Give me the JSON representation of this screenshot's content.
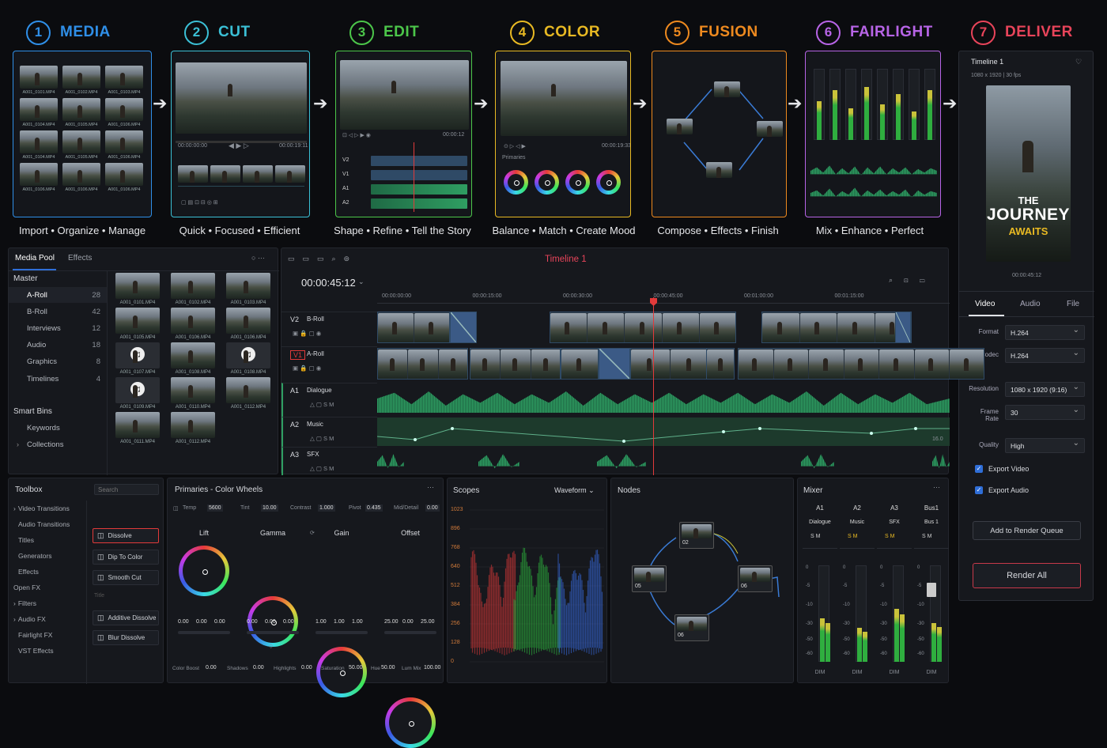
{
  "stages": [
    {
      "num": "1",
      "name": "MEDIA",
      "tagline": "Import • Organize • Manage",
      "color": "#2f8fe8"
    },
    {
      "num": "2",
      "name": "CUT",
      "tagline": "Quick • Focused • Efficient",
      "color": "#3bc0d6"
    },
    {
      "num": "3",
      "name": "EDIT",
      "tagline": "Shape • Refine • Tell the Story",
      "color": "#4cc64a"
    },
    {
      "num": "4",
      "name": "COLOR",
      "tagline": "Balance • Match • Create Mood",
      "color": "#e8b923"
    },
    {
      "num": "5",
      "name": "FUSION",
      "tagline": "Compose • Effects • Finish",
      "color": "#ee8a1f"
    },
    {
      "num": "6",
      "name": "FAIRLIGHT",
      "tagline": "Mix • Enhance • Perfect",
      "color": "#b764e6"
    },
    {
      "num": "7",
      "name": "DELIVER",
      "tagline": "",
      "color": "#e8445a"
    }
  ],
  "media_card": {
    "files": [
      "A001_0101.MP4",
      "A001_0102.MP4",
      "A001_0103.MP4",
      "A001_0104.MP4",
      "A001_0105.MP4",
      "A001_0106.MP4",
      "A001_0104.MP4",
      "A001_0105.MP4",
      "A001_0106.MP4",
      "A001_0106.MP4",
      "A001_0106.MP4",
      "A001_0106.MP4"
    ]
  },
  "cut_card": {
    "tc_in": "00:00:00:00",
    "tc_out": "00:00:19:11"
  },
  "edit_card": {
    "tc": "00:00:12",
    "tracks": [
      "V2",
      "V1",
      "A1",
      "A2"
    ]
  },
  "color_card": {
    "label": "Primaries",
    "tc_out": "00:00:19:33"
  },
  "deliver_card": {
    "title": "Timeline 1",
    "spec": "1080 x 1920 | 30 fps",
    "poster_line1": "THE",
    "poster_line2": "JOURNEY",
    "poster_line3": "AWAITS",
    "tc": "00:00:45:12"
  },
  "media_pool": {
    "tabs": [
      "Media Pool",
      "Effects"
    ],
    "master_label": "Master",
    "bins": [
      {
        "name": "A-Roll",
        "count": "28"
      },
      {
        "name": "B-Roll",
        "count": "42"
      },
      {
        "name": "Interviews",
        "count": "12"
      },
      {
        "name": "Audio",
        "count": "18"
      },
      {
        "name": "Graphics",
        "count": "8"
      },
      {
        "name": "Timelines",
        "count": "4"
      }
    ],
    "smart_label": "Smart Bins",
    "smart": [
      "Keywords",
      "Collections"
    ],
    "clips": [
      "A001_0101.MP4",
      "A001_0102.MP4",
      "A001_0103.MP4",
      "A001_0105.MP4",
      "A001_0106.MP4",
      "A001_0106.MP4",
      "A001_0107.MP4",
      "A001_0108.MP4",
      "A001_0108.MP4",
      "A001_0109.MP4",
      "A001_0110.MP4",
      "A001_0112.MP4",
      "A001_0111.MP4",
      "A001_0112.MP4"
    ]
  },
  "timeline": {
    "name": "Timeline 1",
    "timecode": "00:00:45:12",
    "ruler": [
      "00:00:00:00",
      "00:00:15:00",
      "00:00:30:00",
      "00:00:45:00",
      "00:01:00:00",
      "00:01:15:00"
    ],
    "tracks": [
      {
        "id": "V2",
        "name": "B-Roll"
      },
      {
        "id": "V1",
        "name": "A-Roll"
      },
      {
        "id": "A1",
        "name": "Dialogue"
      },
      {
        "id": "A2",
        "name": "Music"
      },
      {
        "id": "A3",
        "name": "SFX"
      }
    ],
    "music_end": "16.0"
  },
  "toolbox": {
    "title": "Toolbox",
    "search_placeholder": "Search",
    "items": [
      "Video Transitions",
      "Audio Transitions",
      "Titles",
      "Generators",
      "Effects",
      "Open FX",
      "Filters",
      "Audio FX",
      "Fairlight FX",
      "VST Effects"
    ],
    "effects": [
      "Dissolve",
      "Dip To Color",
      "Smooth Cut",
      "Additive Dissolve",
      "Blur Dissolve"
    ],
    "group_label": "Title"
  },
  "primaries": {
    "title": "Primaries - Color Wheels",
    "params": [
      {
        "k": "Temp",
        "v": "5600"
      },
      {
        "k": "Tint",
        "v": "10.00"
      },
      {
        "k": "Contrast",
        "v": "1.000"
      },
      {
        "k": "Pivot",
        "v": "0.435"
      },
      {
        "k": "Mid/Detail",
        "v": "0.00"
      }
    ],
    "wheels": [
      {
        "name": "Lift",
        "vals": [
          "0.00",
          "0.00",
          "0.00"
        ]
      },
      {
        "name": "Gamma",
        "vals": [
          "0.00",
          "0.00",
          "0.00"
        ]
      },
      {
        "name": "Gain",
        "vals": [
          "1.00",
          "1.00",
          "1.00"
        ]
      },
      {
        "name": "Offset",
        "vals": [
          "25.00",
          "0.00",
          "25.00"
        ]
      }
    ],
    "bottom": [
      {
        "k": "Color Boost",
        "v": "0.00"
      },
      {
        "k": "Shadows",
        "v": "0.00"
      },
      {
        "k": "Highlights",
        "v": "0.00"
      },
      {
        "k": "Saturation",
        "v": "50.00"
      },
      {
        "k": "Hue",
        "v": "50.00"
      },
      {
        "k": "Lum Mix",
        "v": "100.00"
      }
    ]
  },
  "scopes": {
    "title": "Scopes",
    "mode": "Waveform",
    "ticks": [
      "1023",
      "896",
      "768",
      "640",
      "512",
      "384",
      "256",
      "128",
      "0"
    ]
  },
  "nodes": {
    "title": "Nodes",
    "labels": [
      "02",
      "05",
      "06",
      "06"
    ]
  },
  "mixer": {
    "title": "Mixer",
    "channels": [
      {
        "id": "A1",
        "name": "Dialogue"
      },
      {
        "id": "A2",
        "name": "Music"
      },
      {
        "id": "A3",
        "name": "SFX"
      },
      {
        "id": "Bus1",
        "name": "Bus 1"
      }
    ],
    "scale": [
      "0",
      "-5",
      "-10",
      "-30",
      "-50",
      "-60"
    ],
    "dim": "DIM",
    "levels": [
      0.45,
      0.35,
      0.55,
      0.4
    ]
  },
  "deliver": {
    "tabs": [
      "Video",
      "Audio",
      "File"
    ],
    "fields": [
      {
        "k": "Format",
        "v": "H.264"
      },
      {
        "k": "Codec",
        "v": "H.264"
      },
      {
        "k": "Resolution",
        "v": "1080 x 1920 (9:16)"
      },
      {
        "k": "Frame Rate",
        "v": "30"
      },
      {
        "k": "Quality",
        "v": "High"
      }
    ],
    "export_video": "Export Video",
    "export_audio": "Export Audio",
    "add_queue": "Add to Render Queue",
    "render_all": "Render All"
  }
}
